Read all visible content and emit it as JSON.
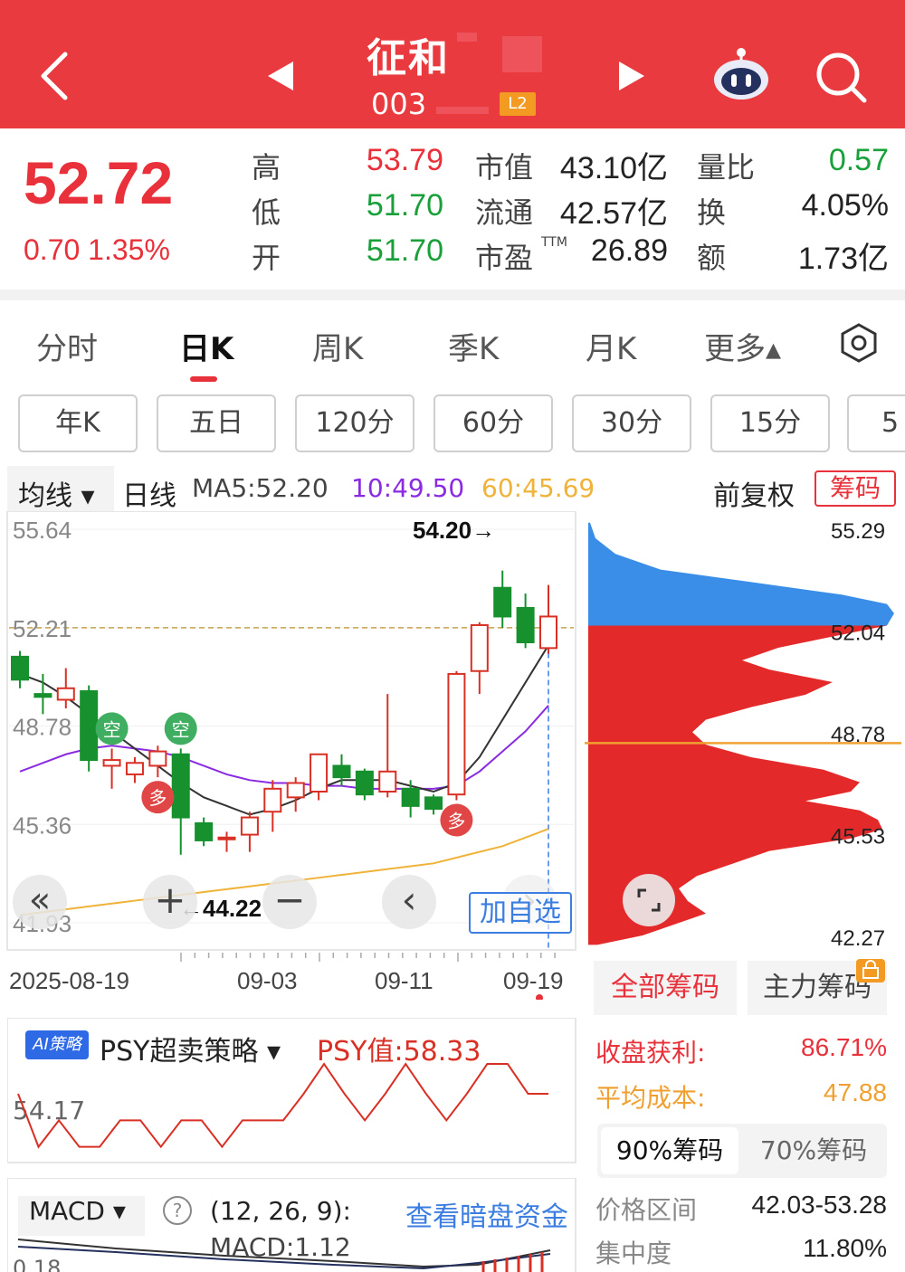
{
  "header": {
    "stock_name": "征和",
    "stock_code": "003",
    "level_badge": "L2",
    "icons": [
      "back-arrow-icon",
      "prev-triangle-icon",
      "next-triangle-icon",
      "robot-assistant-icon",
      "search-icon"
    ]
  },
  "quote": {
    "last_price": "52.72",
    "change": "0.70  1.35%",
    "high_label": "高",
    "high": "53.79",
    "low_label": "低",
    "low": "51.70",
    "open_label": "开",
    "open": "51.70",
    "mktcap_label": "市值",
    "mktcap": "43.10亿",
    "float_label": "流通",
    "float": "42.57亿",
    "pe_label": "市盈",
    "pe_sup": "TTM",
    "pe": "26.89",
    "vol_ratio_label": "量比",
    "vol_ratio": "0.57",
    "turnover_label": "换",
    "turnover": "4.05%",
    "amount_label": "额",
    "amount": "1.73亿"
  },
  "period_tabs": {
    "t1": "分时",
    "t2": "日K",
    "t3": "周K",
    "t4": "季K",
    "t5": "月K",
    "t6": "更多▴",
    "active": "日K"
  },
  "minute_chips": {
    "c1": "年K",
    "c2": "五日",
    "c3": "120分",
    "c4": "60分",
    "c5": "30分",
    "c6": "15分",
    "c7": "5"
  },
  "chart_header": {
    "indicator": "均线 ▾",
    "line_type": "日线",
    "ma5": "MA5:52.20",
    "ma10": "10:49.50",
    "ma60": "60:45.69",
    "adjust": "前复权",
    "chip_button": "筹码"
  },
  "colors": {
    "up": "#d93025",
    "down": "#17902e",
    "ma5": "#333333",
    "ma10": "#8a2be2",
    "ma60": "#f0b33a",
    "chip_red": "#e32929",
    "chip_blue": "#3b8ee8"
  },
  "chart_data": {
    "type": "candlestick",
    "y_axis_labels": [
      "55.64",
      "52.21",
      "48.78",
      "45.36",
      "41.93"
    ],
    "ylim": [
      41.93,
      55.64
    ],
    "x_tick_labels": [
      "2025-08-19",
      "09-03",
      "09-11",
      "09-19"
    ],
    "max_annotation": "54.20→",
    "min_annotation": "←44.22",
    "candles": [
      {
        "o": 51.2,
        "h": 51.4,
        "c": 50.4,
        "l": 50.1
      },
      {
        "o": 49.9,
        "h": 50.6,
        "c": 49.8,
        "l": 49.2
      },
      {
        "o": 49.7,
        "h": 50.8,
        "c": 50.1,
        "l": 49.4
      },
      {
        "o": 50.0,
        "h": 50.2,
        "c": 47.6,
        "l": 47.2
      },
      {
        "o": 47.4,
        "h": 48.0,
        "c": 47.6,
        "l": 46.6
      },
      {
        "o": 47.1,
        "h": 47.7,
        "c": 47.5,
        "l": 46.8
      },
      {
        "o": 47.4,
        "h": 48.1,
        "c": 47.9,
        "l": 47.0
      },
      {
        "o": 47.8,
        "h": 48.0,
        "c": 45.6,
        "l": 44.3
      },
      {
        "o": 45.4,
        "h": 45.6,
        "c": 44.8,
        "l": 44.6
      },
      {
        "o": 44.9,
        "h": 45.1,
        "c": 44.9,
        "l": 44.4
      },
      {
        "o": 45.0,
        "h": 45.8,
        "c": 45.6,
        "l": 44.4
      },
      {
        "o": 45.8,
        "h": 46.9,
        "c": 46.6,
        "l": 45.1
      },
      {
        "o": 46.3,
        "h": 47.0,
        "c": 46.8,
        "l": 45.8
      },
      {
        "o": 46.5,
        "h": 47.8,
        "c": 47.8,
        "l": 46.2
      },
      {
        "o": 47.4,
        "h": 47.8,
        "c": 47.0,
        "l": 46.7
      },
      {
        "o": 47.2,
        "h": 47.3,
        "c": 46.4,
        "l": 46.2
      },
      {
        "o": 46.5,
        "h": 49.9,
        "c": 47.2,
        "l": 46.3
      },
      {
        "o": 46.6,
        "h": 46.9,
        "c": 46.0,
        "l": 45.6
      },
      {
        "o": 46.3,
        "h": 46.4,
        "c": 45.9,
        "l": 45.7
      },
      {
        "o": 46.4,
        "h": 50.7,
        "c": 50.6,
        "l": 46.2
      },
      {
        "o": 50.7,
        "h": 52.4,
        "c": 52.3,
        "l": 49.9
      },
      {
        "o": 53.6,
        "h": 54.2,
        "c": 52.6,
        "l": 52.2
      },
      {
        "o": 52.9,
        "h": 53.4,
        "c": 51.7,
        "l": 51.5
      },
      {
        "o": 51.5,
        "h": 53.7,
        "c": 52.6,
        "l": 51.3
      }
    ],
    "ma5": [
      50.6,
      50.3,
      49.8,
      49.2,
      48.6,
      48.0,
      47.4,
      46.8,
      46.3,
      46.0,
      45.7,
      45.9,
      46.2,
      46.6,
      46.9,
      46.9,
      46.9,
      46.7,
      46.5,
      46.8,
      47.7,
      49.0,
      50.3,
      51.6
    ],
    "ma10": [
      47.2,
      47.5,
      47.8,
      48.0,
      48.1,
      48.0,
      47.9,
      47.7,
      47.4,
      47.1,
      46.9,
      46.8,
      46.8,
      46.7,
      46.7,
      46.6,
      46.6,
      46.6,
      46.6,
      46.7,
      47.2,
      47.9,
      48.6,
      49.5
    ],
    "ma60": [
      42.2,
      42.3,
      42.4,
      42.5,
      42.6,
      42.7,
      42.8,
      42.9,
      43.0,
      43.1,
      43.2,
      43.3,
      43.4,
      43.5,
      43.6,
      43.7,
      43.8,
      43.9,
      44.0,
      44.2,
      44.4,
      44.6,
      44.9,
      45.2
    ],
    "signals": [
      {
        "text": "空",
        "i": 4
      },
      {
        "text": "空",
        "i": 7
      },
      {
        "text": "多",
        "i": 6
      },
      {
        "text": "多",
        "i": 19
      }
    ],
    "chip_labels": [
      "55.29",
      "52.04",
      "48.78",
      "45.53",
      "42.27"
    ]
  },
  "chart_controls": {
    "collapse": "«",
    "zoom_in": "+",
    "zoom_out": "−",
    "prev": "‹",
    "next": "›",
    "add_watch": "加自选"
  },
  "psy": {
    "badge": "AI策略",
    "title": "PSY超卖策略 ▾",
    "value": "PSY值:58.33",
    "level_label": "54.17",
    "values": [
      58,
      42,
      50,
      42,
      42,
      50,
      50,
      42,
      50,
      50,
      42,
      50,
      50,
      50,
      58,
      67,
      58,
      50,
      58,
      67,
      58,
      50,
      58,
      67,
      67,
      58,
      58
    ]
  },
  "macd": {
    "name": "MACD ▾",
    "help": "?",
    "params": "(12, 26, 9):",
    "value": "MACD:1.12",
    "link": "查看暗盘资金",
    "level_label": "0.18"
  },
  "chip_panel": {
    "tab_all": "全部筹码",
    "tab_main": "主力筹码",
    "profit_label": "收盘获利:",
    "profit_value": "86.71%",
    "avg_cost_label": "平均成本:",
    "avg_cost_value": "47.88",
    "sub_tab_90": "90%筹码",
    "sub_tab_70": "70%筹码",
    "range_label": "价格区间",
    "range_value": "42.03-53.28",
    "conc_label": "集中度",
    "conc_value": "11.80%"
  }
}
